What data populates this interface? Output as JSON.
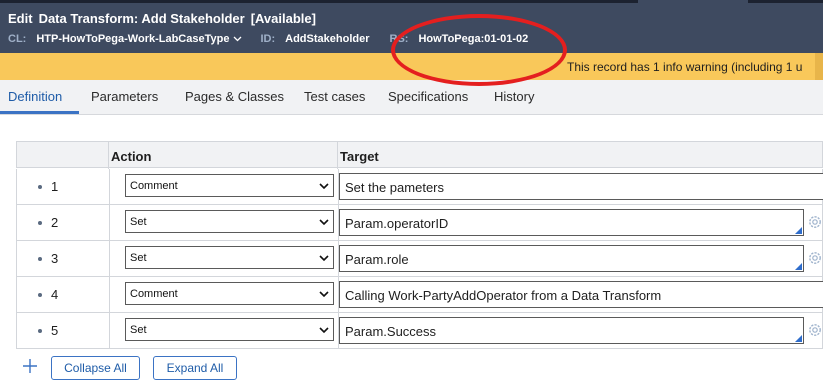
{
  "header": {
    "edit_label": "Edit",
    "rule_title": "Data Transform: Add Stakeholder",
    "status": "[Available]",
    "class_label": "CL:",
    "class_value": "HTP-HowToPega-Work-LabCaseType",
    "id_label": "ID:",
    "id_value": "AddStakeholder",
    "ruleset_label": "RS:",
    "ruleset_value": "HowToPega:01-01-02"
  },
  "warning": {
    "text": "This record has 1 info warning (including 1 u"
  },
  "tabs": [
    "Definition",
    "Parameters",
    "Pages & Classes",
    "Test cases",
    "Specifications",
    "History"
  ],
  "grid": {
    "col_action": "Action",
    "col_target": "Target",
    "rows": [
      {
        "num": "1",
        "action": "Comment",
        "target": "Set the pameters"
      },
      {
        "num": "2",
        "action": "Set",
        "target": "Param.operatorID"
      },
      {
        "num": "3",
        "action": "Set",
        "target": "Param.role"
      },
      {
        "num": "4",
        "action": "Comment",
        "target": "Calling Work-PartyAddOperator from a Data Transform"
      },
      {
        "num": "5",
        "action": "Set",
        "target": "Param.Success"
      }
    ]
  },
  "footer": {
    "collapse_label": "Collapse All",
    "expand_label": "Expand All"
  },
  "icons": {
    "dropdown": "chevron-down-icon",
    "add": "plus-icon",
    "gear": "gear-icon",
    "resize": "corner-resize-icon"
  },
  "colors": {
    "header_bg": "#3e4a60",
    "warning_bg": "#f9c85a",
    "accent": "#3b73c4",
    "annotation": "#e41f1f"
  }
}
